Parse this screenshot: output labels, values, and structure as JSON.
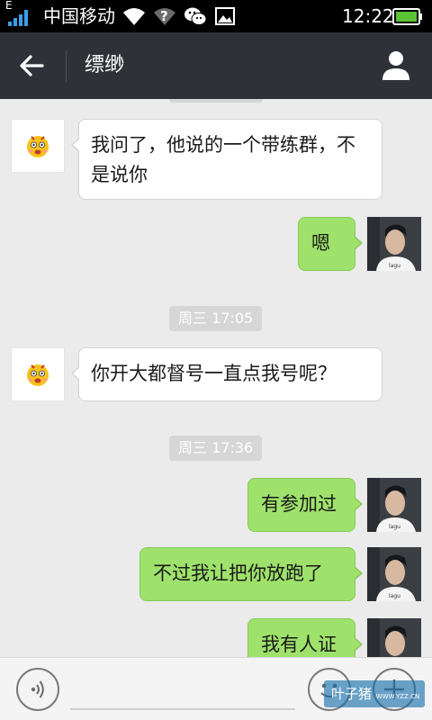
{
  "status_bar": {
    "network_type": "E",
    "carrier": "中国移动",
    "time": "12:22",
    "icons": [
      "signal-icon",
      "wifi-icon",
      "unknown-signal-icon",
      "wechat-icon",
      "image-icon",
      "battery-icon"
    ]
  },
  "title_bar": {
    "title": "缥缈",
    "back_icon": "arrow-left-icon",
    "profile_icon": "person-icon"
  },
  "messages": [
    {
      "sender": "other",
      "text": "我问了，他说的一个带练群，不是说你"
    },
    {
      "sender": "me",
      "text": "嗯"
    },
    {
      "type": "timestamp",
      "text": "周三 17:05"
    },
    {
      "sender": "other",
      "text": "你开大都督号一直点我号呢？"
    },
    {
      "type": "timestamp",
      "text": "周三 17:36"
    },
    {
      "sender": "me",
      "text": "有参加过"
    },
    {
      "sender": "me",
      "text": "不过我让把你放跑了"
    },
    {
      "sender": "me",
      "text": "我有人证"
    }
  ],
  "input_bar": {
    "voice_icon": "voice-icon",
    "emoji_icon": "emoji-icon",
    "plus_icon": "plus-icon",
    "input_value": ""
  },
  "watermark": {
    "text": "叶子猪",
    "subtext": "WWW.YZZ.CN"
  },
  "colors": {
    "title_bar": "#2e3238",
    "chat_background": "#ebebeb",
    "outgoing_bubble": "#9ee26b",
    "incoming_bubble": "#ffffff",
    "timestamp_badge": "#d6d6d6"
  }
}
